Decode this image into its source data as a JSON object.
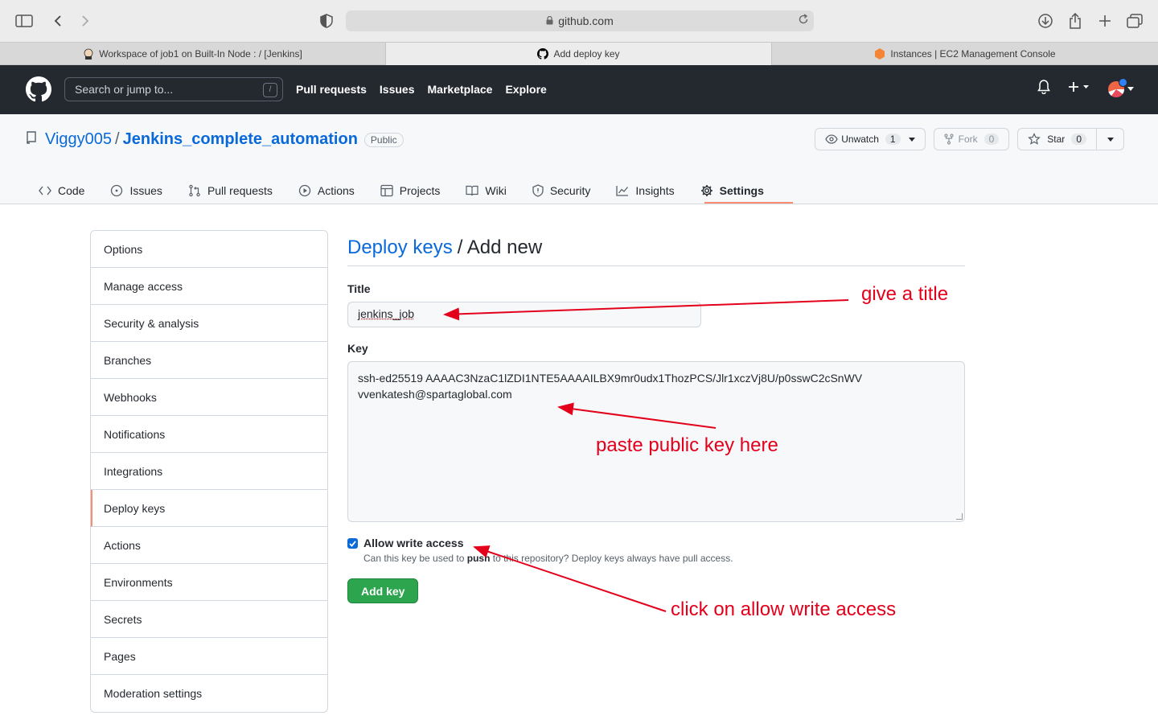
{
  "browser": {
    "url": "github.com",
    "tabs": [
      {
        "title": "Workspace of job1 on Built-In Node : / [Jenkins]"
      },
      {
        "title": "Add deploy key"
      },
      {
        "title": "Instances | EC2 Management Console"
      }
    ]
  },
  "header": {
    "search_placeholder": "Search or jump to...",
    "search_shortcut": "/",
    "nav": [
      "Pull requests",
      "Issues",
      "Marketplace",
      "Explore"
    ]
  },
  "repo": {
    "owner": "Viggy005",
    "separator": "/",
    "name": "Jenkins_complete_automation",
    "visibility": "Public",
    "unwatch_label": "Unwatch",
    "unwatch_count": "1",
    "fork_label": "Fork",
    "fork_count": "0",
    "star_label": "Star",
    "star_count": "0",
    "tabs": [
      "Code",
      "Issues",
      "Pull requests",
      "Actions",
      "Projects",
      "Wiki",
      "Security",
      "Insights",
      "Settings"
    ]
  },
  "sidebar": {
    "items": [
      "Options",
      "Manage access",
      "Security & analysis",
      "Branches",
      "Webhooks",
      "Notifications",
      "Integrations",
      "Deploy keys",
      "Actions",
      "Environments",
      "Secrets",
      "Pages",
      "Moderation settings"
    ],
    "active": "Deploy keys"
  },
  "form": {
    "breadcrumb_link": "Deploy keys",
    "breadcrumb_rest": "/ Add new",
    "title_label": "Title",
    "title_value": "jenkins_job",
    "key_label": "Key",
    "key_line1": "ssh-ed25519 AAAAC3NzaC1lZDI1NTE5AAAAILBX9mr0udx1ThozPCS/Jlr1xczVj8U/p0sswC2cSnWV",
    "key_line2": "vvenkatesh@spartaglobal.com",
    "allow_write_label": "Allow write access",
    "allow_write_checked": true,
    "note_before": "Can this key be used to ",
    "note_bold": "push",
    "note_after": " to this repository? Deploy keys always have pull access.",
    "submit_label": "Add key"
  },
  "annotations": {
    "title_hint": "give a title",
    "key_hint": "paste public key here",
    "write_hint": "click on allow write access",
    "color": "#e4001b"
  },
  "colors": {
    "header_bg": "#24292f",
    "link": "#0969da",
    "primary_button": "#2da44e",
    "active_accent": "#fd8c73"
  }
}
